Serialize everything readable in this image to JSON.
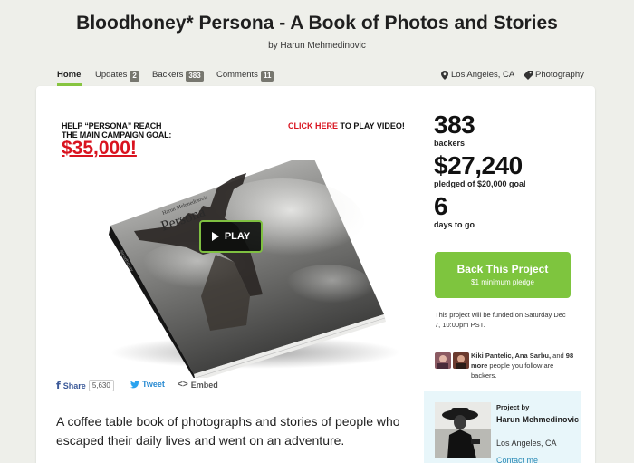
{
  "header": {
    "title": "Bloodhoney* Persona - A Book of Photos and Stories",
    "byline": "by Harun Mehmedinovic"
  },
  "nav": {
    "home": "Home",
    "updates": "Updates",
    "updates_count": "2",
    "backers": "Backers",
    "backers_count": "383",
    "comments": "Comments",
    "comments_count": "11",
    "location": "Los Angeles, CA",
    "category": "Photography",
    "accent_color": "#87c540"
  },
  "video": {
    "promo_line1": "HELP “PERSONA” REACH",
    "promo_line2": "THE MAIN CAMPAIGN GOAL:",
    "promo_goal": "$35,000!",
    "click_here": "CLICK HERE",
    "click_rest": " TO PLAY VIDEO!",
    "book_small_text": "Harun Mehmedinovic",
    "book_title": "Persona",
    "book_spine": "Bloodhoney",
    "play_label": "PLAY",
    "play_icon": "play-triangle-icon"
  },
  "share": {
    "facebook_label": "Share",
    "facebook_count": "5,630",
    "tweet_label": "Tweet",
    "embed_label": "Embed",
    "embed_icon_glyph": "<>"
  },
  "blurb": "A coffee table book of photographs and stories of people who escaped their daily lives and went on an adventure.",
  "stats": {
    "backers_value": "383",
    "backers_label": "backers",
    "pledged_value": "$27,240",
    "pledged_label": "pledged of $20,000 goal",
    "days_value": "6",
    "days_label": "days to go"
  },
  "cta": {
    "label": "Back This Project",
    "sublabel": "$1 minimum pledge",
    "color": "#7ec53e"
  },
  "funding_note": "This project will be funded on Saturday Dec 7, 10:00pm PST.",
  "friends": {
    "names_bold": "Kiki Pantelic, Ana Sarbu,",
    "and": " and ",
    "more_bold": "98 more",
    "rest": " people you follow are backers."
  },
  "creator": {
    "heading": "Project by",
    "name": "Harun Mehmedinovic",
    "location": "Los Angeles, CA",
    "contact": "Contact me"
  }
}
